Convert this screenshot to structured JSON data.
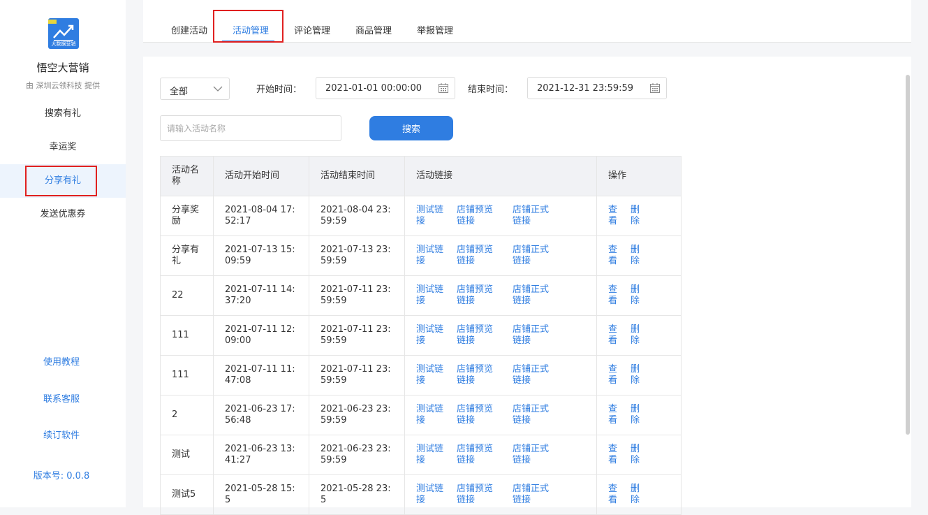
{
  "sidebar": {
    "logo_caption": "大数据营销",
    "app_name": "悟空大营销",
    "provider": "由 深圳云领科技 提供",
    "items": [
      {
        "label": "搜索有礼"
      },
      {
        "label": "幸运奖"
      },
      {
        "label": "分享有礼"
      },
      {
        "label": "发送优惠券"
      }
    ],
    "links": {
      "tutorial": "使用教程",
      "support": "联系客服",
      "renew": "续订软件",
      "version": "版本号: 0.0.8"
    }
  },
  "tabs": [
    {
      "label": "创建活动"
    },
    {
      "label": "活动管理"
    },
    {
      "label": "评论管理"
    },
    {
      "label": "商品管理"
    },
    {
      "label": "举报管理"
    }
  ],
  "filters": {
    "status_select": "全部",
    "start_label": "开始时间：",
    "start_value": "2021-01-01 00:00:00",
    "end_label": "结束时间：",
    "end_value": "2021-12-31 23:59:59",
    "name_placeholder": "请输入活动名称",
    "search_label": "搜索"
  },
  "table": {
    "headers": [
      "活动名称",
      "活动开始时间",
      "活动结束时间",
      "活动链接",
      "操作"
    ],
    "link_labels": [
      "测试链接",
      "店铺预览链接",
      "店铺正式链接"
    ],
    "action_labels": [
      "查看",
      "删除"
    ],
    "rows": [
      {
        "name": "分享奖励",
        "start": "2021-08-04 17:52:17",
        "end": "2021-08-04 23:59:59"
      },
      {
        "name": "分享有礼",
        "start": "2021-07-13 15:09:59",
        "end": "2021-07-13 23:59:59"
      },
      {
        "name": "22",
        "start": "2021-07-11 14:37:20",
        "end": "2021-07-11 23:59:59"
      },
      {
        "name": "111",
        "start": "2021-07-11 12:09:00",
        "end": "2021-07-11 23:59:59"
      },
      {
        "name": "111",
        "start": "2021-07-11 11:47:08",
        "end": "2021-07-11 23:59:59"
      },
      {
        "name": "2",
        "start": "2021-06-23 17:56:48",
        "end": "2021-06-23 23:59:59"
      },
      {
        "name": "测试",
        "start": "2021-06-23 13:41:27",
        "end": "2021-06-23 23:59:59"
      },
      {
        "name": "测试5",
        "start": "2021-05-28 15:5",
        "end": "2021-05-28 23:5"
      }
    ]
  }
}
